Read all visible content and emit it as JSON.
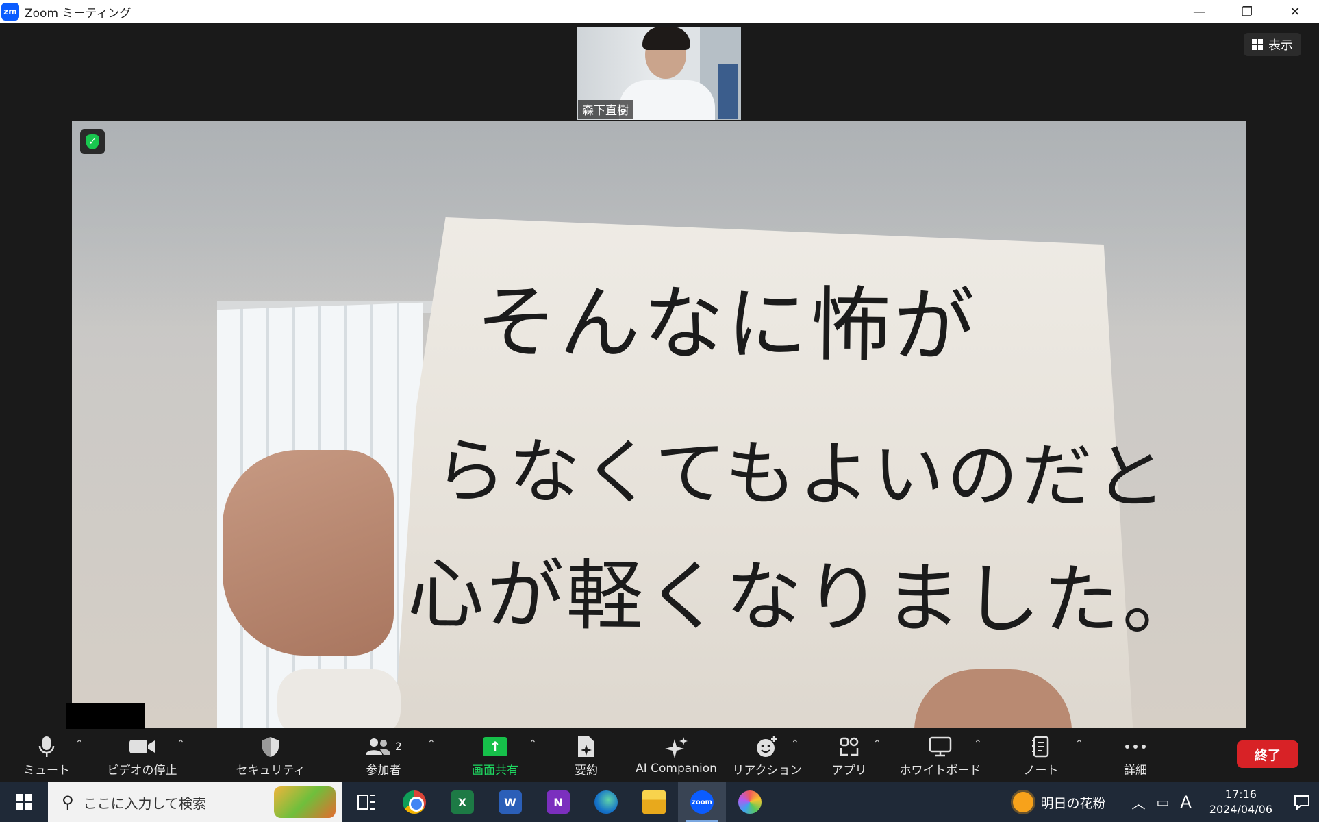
{
  "window": {
    "logo_text": "zm",
    "title": "Zoom ミーティング",
    "controls": {
      "minimize": "—",
      "restore": "❐",
      "close": "✕"
    }
  },
  "meeting": {
    "view_button": "表示",
    "thumbnail": {
      "name": "森下直樹"
    },
    "sign_lines": [
      "そんなに怖が",
      "らなくてもよいのだと",
      "心が軽くなりました。"
    ]
  },
  "toolbar": {
    "mute": "ミュート",
    "video": "ビデオの停止",
    "security": "セキュリティ",
    "participants": "参加者",
    "participants_count": "2",
    "share": "画面共有",
    "summary": "要約",
    "ai": "AI Companion",
    "reactions": "リアクション",
    "apps": "アプリ",
    "whiteboard": "ホワイトボード",
    "notes": "ノート",
    "more": "詳細",
    "end": "終了",
    "caret": "⌃"
  },
  "taskbar": {
    "search_placeholder": "ここに入力して検索",
    "excel": "X",
    "word": "W",
    "onenote": "N",
    "zoom": "zoom",
    "weather": "明日の花粉",
    "input_mode": "A",
    "time": "17:16",
    "date": "2024/04/06"
  },
  "colors": {
    "share_green": "#1ed760",
    "end_red": "#d82226",
    "zoom_blue": "#0b5cff"
  }
}
